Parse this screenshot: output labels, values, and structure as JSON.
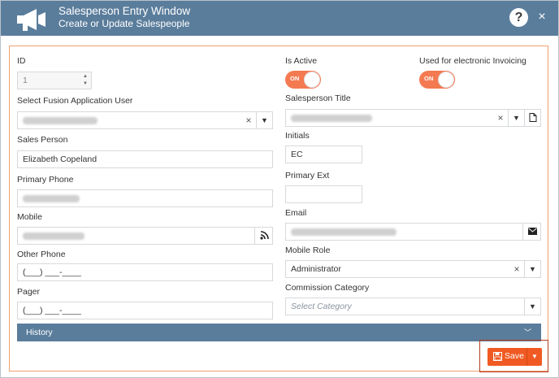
{
  "window": {
    "title": "Salesperson Entry Window",
    "subtitle": "Create or Update Salespeople",
    "help_label": "?",
    "close_label": "×"
  },
  "fields": {
    "id": {
      "label": "ID",
      "value": "1"
    },
    "fusion_user": {
      "label": "Select Fusion Application User"
    },
    "sales_person": {
      "label": "Sales Person",
      "value": "Elizabeth Copeland"
    },
    "primary_phone": {
      "label": "Primary Phone"
    },
    "mobile": {
      "label": "Mobile"
    },
    "other_phone": {
      "label": "Other Phone",
      "value": "(___) ___-____"
    },
    "pager": {
      "label": "Pager",
      "value": "(___) ___-____"
    },
    "is_active": {
      "label": "Is Active",
      "state": "ON"
    },
    "electronic_invoicing": {
      "label": "Used for electronic Invoicing",
      "state": "ON"
    },
    "salesperson_title": {
      "label": "Salesperson Title"
    },
    "initials": {
      "label": "Initials",
      "value": "EC"
    },
    "primary_ext": {
      "label": "Primary Ext",
      "value": ""
    },
    "email": {
      "label": "Email"
    },
    "mobile_role": {
      "label": "Mobile Role",
      "value": "Administrator"
    },
    "commission_category": {
      "label": "Commission Category",
      "placeholder": "Select Category"
    }
  },
  "history": {
    "label": "History"
  },
  "footer": {
    "save_label": "Save"
  },
  "colors": {
    "header": "#5b7d9c",
    "accent": "#f05a22",
    "toggle": "#f47a52"
  },
  "icons": [
    "megaphone-icon",
    "help-icon",
    "close-icon",
    "rss-icon",
    "envelope-icon",
    "new-document-icon",
    "floppy-disk-icon",
    "chevron-down-icon"
  ]
}
